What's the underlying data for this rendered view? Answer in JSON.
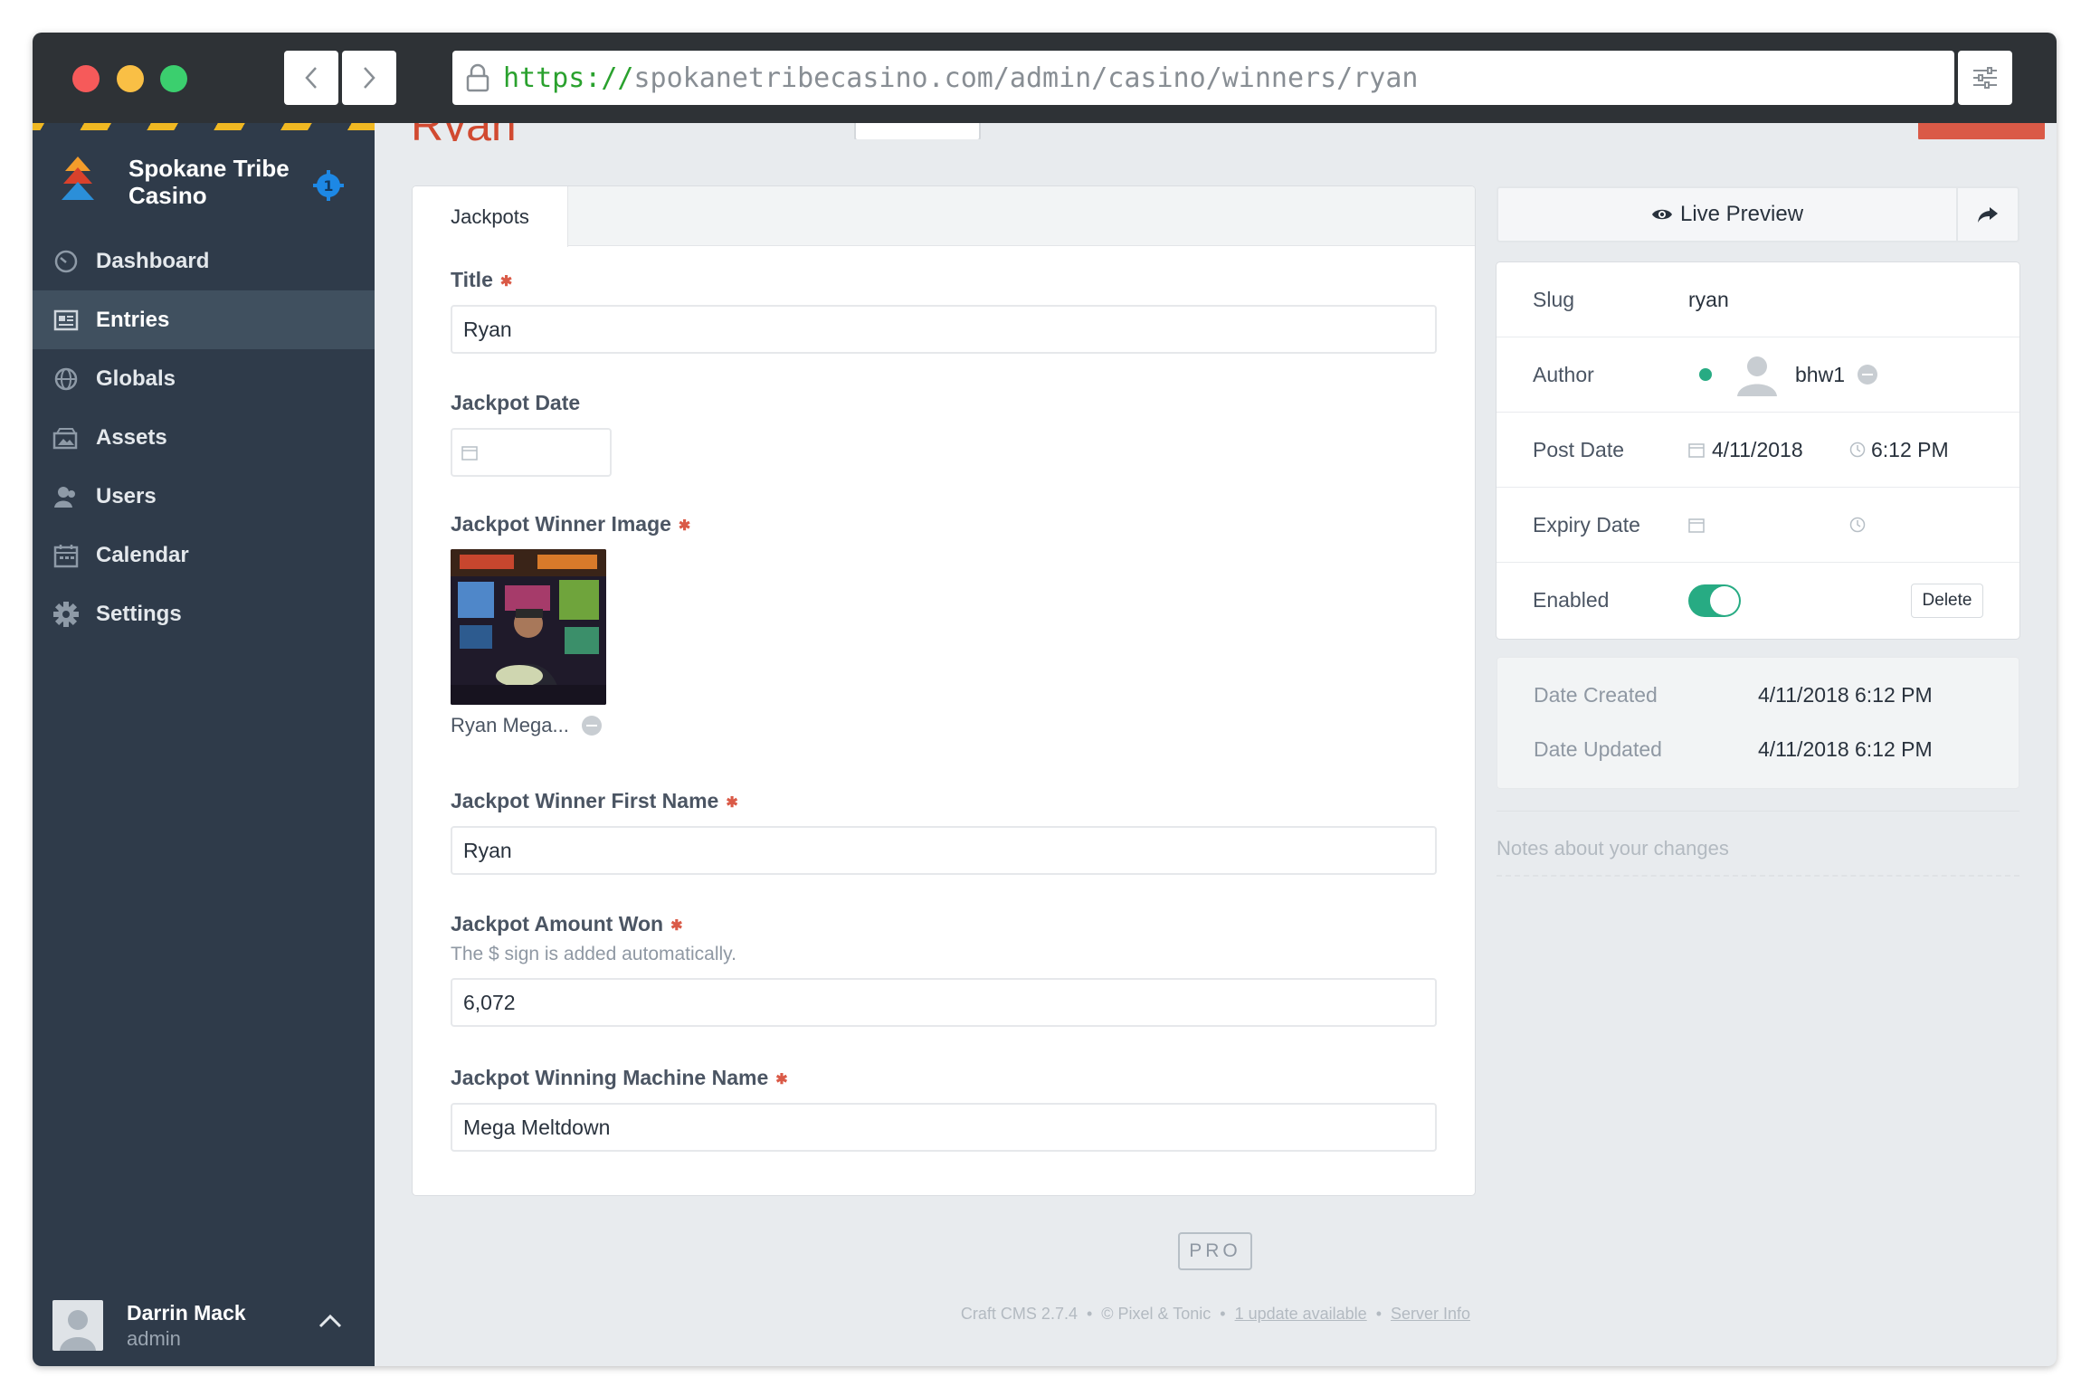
{
  "browser": {
    "url_scheme": "https://",
    "url_rest": "spokanetribecasino.com/admin/casino/winners/ryan"
  },
  "sidebar": {
    "site_name": "Spokane Tribe Casino",
    "badge": "1",
    "items": [
      {
        "label": "Dashboard",
        "icon": "dashboard-icon",
        "active": false
      },
      {
        "label": "Entries",
        "icon": "entries-icon",
        "active": true
      },
      {
        "label": "Globals",
        "icon": "globe-icon",
        "active": false
      },
      {
        "label": "Assets",
        "icon": "assets-icon",
        "active": false
      },
      {
        "label": "Users",
        "icon": "users-icon",
        "active": false
      },
      {
        "label": "Calendar",
        "icon": "calendar-icon",
        "active": false
      },
      {
        "label": "Settings",
        "icon": "gear-icon",
        "active": false
      }
    ],
    "user": {
      "name": "Darrin Mack",
      "role": "admin"
    }
  },
  "page": {
    "title": "Ryan"
  },
  "tabs": [
    {
      "label": "Jackpots"
    }
  ],
  "fields": {
    "title": {
      "label": "Title",
      "value": "Ryan"
    },
    "jackpot_date": {
      "label": "Jackpot Date",
      "value": ""
    },
    "winner_image": {
      "label": "Jackpot Winner Image",
      "caption": "Ryan Mega..."
    },
    "first_name": {
      "label": "Jackpot Winner First Name",
      "value": "Ryan"
    },
    "amount": {
      "label": "Jackpot Amount Won",
      "help": "The $ sign is added automatically.",
      "value": "6,072"
    },
    "machine": {
      "label": "Jackpot Winning Machine Name",
      "value": "Mega Meltdown"
    }
  },
  "right": {
    "live_preview": "Live Preview",
    "slug": {
      "label": "Slug",
      "value": "ryan"
    },
    "author": {
      "label": "Author",
      "value": "bhw1"
    },
    "post_date": {
      "label": "Post Date",
      "date": "4/11/2018",
      "time": "6:12 PM"
    },
    "expiry_date": {
      "label": "Expiry Date"
    },
    "enabled": {
      "label": "Enabled",
      "on": true
    },
    "delete": "Delete",
    "date_created": {
      "label": "Date Created",
      "value": "4/11/2018 6:12 PM"
    },
    "date_updated": {
      "label": "Date Updated",
      "value": "4/11/2018 6:12 PM"
    },
    "notes_placeholder": "Notes about your changes"
  },
  "footer": {
    "pro": "PRO",
    "version": "Craft CMS 2.7.4",
    "company": "© Pixel & Tonic",
    "update": "1 update available",
    "server_info": "Server Info"
  },
  "colors": {
    "sidebar": "#2f3b4a",
    "accent": "#da5a47",
    "enabled": "#27ab83"
  }
}
